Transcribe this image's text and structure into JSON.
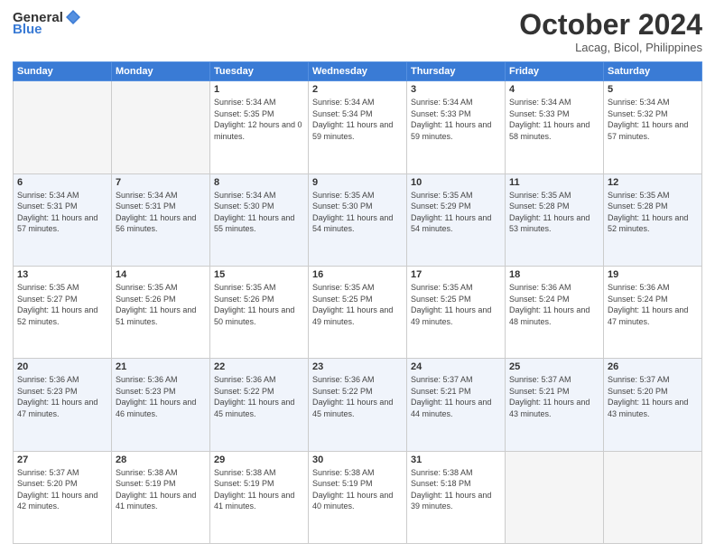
{
  "header": {
    "logo_general": "General",
    "logo_blue": "Blue",
    "month": "October 2024",
    "location": "Lacag, Bicol, Philippines"
  },
  "weekdays": [
    "Sunday",
    "Monday",
    "Tuesday",
    "Wednesday",
    "Thursday",
    "Friday",
    "Saturday"
  ],
  "weeks": [
    [
      {
        "day": "",
        "empty": true
      },
      {
        "day": "",
        "empty": true
      },
      {
        "day": "1",
        "sunrise": "Sunrise: 5:34 AM",
        "sunset": "Sunset: 5:35 PM",
        "daylight": "Daylight: 12 hours and 0 minutes."
      },
      {
        "day": "2",
        "sunrise": "Sunrise: 5:34 AM",
        "sunset": "Sunset: 5:34 PM",
        "daylight": "Daylight: 11 hours and 59 minutes."
      },
      {
        "day": "3",
        "sunrise": "Sunrise: 5:34 AM",
        "sunset": "Sunset: 5:33 PM",
        "daylight": "Daylight: 11 hours and 59 minutes."
      },
      {
        "day": "4",
        "sunrise": "Sunrise: 5:34 AM",
        "sunset": "Sunset: 5:33 PM",
        "daylight": "Daylight: 11 hours and 58 minutes."
      },
      {
        "day": "5",
        "sunrise": "Sunrise: 5:34 AM",
        "sunset": "Sunset: 5:32 PM",
        "daylight": "Daylight: 11 hours and 57 minutes."
      }
    ],
    [
      {
        "day": "6",
        "sunrise": "Sunrise: 5:34 AM",
        "sunset": "Sunset: 5:31 PM",
        "daylight": "Daylight: 11 hours and 57 minutes."
      },
      {
        "day": "7",
        "sunrise": "Sunrise: 5:34 AM",
        "sunset": "Sunset: 5:31 PM",
        "daylight": "Daylight: 11 hours and 56 minutes."
      },
      {
        "day": "8",
        "sunrise": "Sunrise: 5:34 AM",
        "sunset": "Sunset: 5:30 PM",
        "daylight": "Daylight: 11 hours and 55 minutes."
      },
      {
        "day": "9",
        "sunrise": "Sunrise: 5:35 AM",
        "sunset": "Sunset: 5:30 PM",
        "daylight": "Daylight: 11 hours and 54 minutes."
      },
      {
        "day": "10",
        "sunrise": "Sunrise: 5:35 AM",
        "sunset": "Sunset: 5:29 PM",
        "daylight": "Daylight: 11 hours and 54 minutes."
      },
      {
        "day": "11",
        "sunrise": "Sunrise: 5:35 AM",
        "sunset": "Sunset: 5:28 PM",
        "daylight": "Daylight: 11 hours and 53 minutes."
      },
      {
        "day": "12",
        "sunrise": "Sunrise: 5:35 AM",
        "sunset": "Sunset: 5:28 PM",
        "daylight": "Daylight: 11 hours and 52 minutes."
      }
    ],
    [
      {
        "day": "13",
        "sunrise": "Sunrise: 5:35 AM",
        "sunset": "Sunset: 5:27 PM",
        "daylight": "Daylight: 11 hours and 52 minutes."
      },
      {
        "day": "14",
        "sunrise": "Sunrise: 5:35 AM",
        "sunset": "Sunset: 5:26 PM",
        "daylight": "Daylight: 11 hours and 51 minutes."
      },
      {
        "day": "15",
        "sunrise": "Sunrise: 5:35 AM",
        "sunset": "Sunset: 5:26 PM",
        "daylight": "Daylight: 11 hours and 50 minutes."
      },
      {
        "day": "16",
        "sunrise": "Sunrise: 5:35 AM",
        "sunset": "Sunset: 5:25 PM",
        "daylight": "Daylight: 11 hours and 49 minutes."
      },
      {
        "day": "17",
        "sunrise": "Sunrise: 5:35 AM",
        "sunset": "Sunset: 5:25 PM",
        "daylight": "Daylight: 11 hours and 49 minutes."
      },
      {
        "day": "18",
        "sunrise": "Sunrise: 5:36 AM",
        "sunset": "Sunset: 5:24 PM",
        "daylight": "Daylight: 11 hours and 48 minutes."
      },
      {
        "day": "19",
        "sunrise": "Sunrise: 5:36 AM",
        "sunset": "Sunset: 5:24 PM",
        "daylight": "Daylight: 11 hours and 47 minutes."
      }
    ],
    [
      {
        "day": "20",
        "sunrise": "Sunrise: 5:36 AM",
        "sunset": "Sunset: 5:23 PM",
        "daylight": "Daylight: 11 hours and 47 minutes."
      },
      {
        "day": "21",
        "sunrise": "Sunrise: 5:36 AM",
        "sunset": "Sunset: 5:23 PM",
        "daylight": "Daylight: 11 hours and 46 minutes."
      },
      {
        "day": "22",
        "sunrise": "Sunrise: 5:36 AM",
        "sunset": "Sunset: 5:22 PM",
        "daylight": "Daylight: 11 hours and 45 minutes."
      },
      {
        "day": "23",
        "sunrise": "Sunrise: 5:36 AM",
        "sunset": "Sunset: 5:22 PM",
        "daylight": "Daylight: 11 hours and 45 minutes."
      },
      {
        "day": "24",
        "sunrise": "Sunrise: 5:37 AM",
        "sunset": "Sunset: 5:21 PM",
        "daylight": "Daylight: 11 hours and 44 minutes."
      },
      {
        "day": "25",
        "sunrise": "Sunrise: 5:37 AM",
        "sunset": "Sunset: 5:21 PM",
        "daylight": "Daylight: 11 hours and 43 minutes."
      },
      {
        "day": "26",
        "sunrise": "Sunrise: 5:37 AM",
        "sunset": "Sunset: 5:20 PM",
        "daylight": "Daylight: 11 hours and 43 minutes."
      }
    ],
    [
      {
        "day": "27",
        "sunrise": "Sunrise: 5:37 AM",
        "sunset": "Sunset: 5:20 PM",
        "daylight": "Daylight: 11 hours and 42 minutes."
      },
      {
        "day": "28",
        "sunrise": "Sunrise: 5:38 AM",
        "sunset": "Sunset: 5:19 PM",
        "daylight": "Daylight: 11 hours and 41 minutes."
      },
      {
        "day": "29",
        "sunrise": "Sunrise: 5:38 AM",
        "sunset": "Sunset: 5:19 PM",
        "daylight": "Daylight: 11 hours and 41 minutes."
      },
      {
        "day": "30",
        "sunrise": "Sunrise: 5:38 AM",
        "sunset": "Sunset: 5:19 PM",
        "daylight": "Daylight: 11 hours and 40 minutes."
      },
      {
        "day": "31",
        "sunrise": "Sunrise: 5:38 AM",
        "sunset": "Sunset: 5:18 PM",
        "daylight": "Daylight: 11 hours and 39 minutes."
      },
      {
        "day": "",
        "empty": true
      },
      {
        "day": "",
        "empty": true
      }
    ]
  ]
}
